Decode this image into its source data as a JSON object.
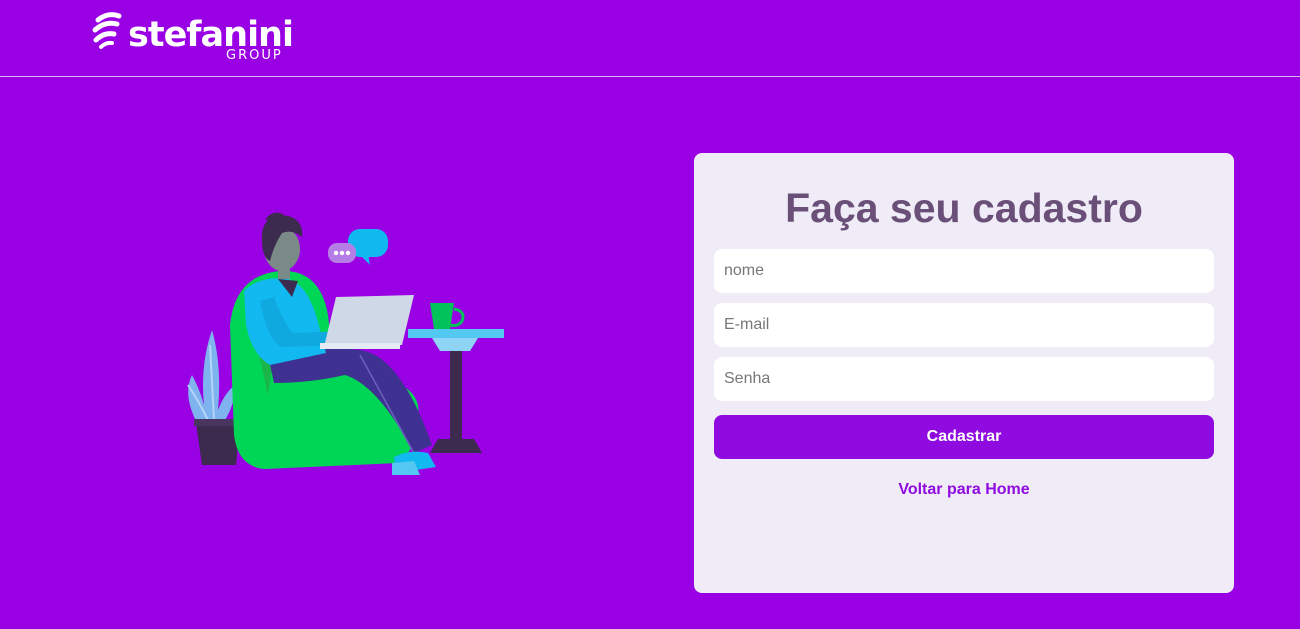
{
  "header": {
    "logo": {
      "word": "stefanini",
      "sub": "GROUP"
    }
  },
  "illustration": {
    "icon": "person-with-laptop-illustration"
  },
  "signup": {
    "title": "Faça seu cadastro",
    "name_placeholder": "nome",
    "email_placeholder": "E-mail",
    "password_placeholder": "Senha",
    "submit_label": "Cadastrar",
    "back_link": "Voltar para Home"
  },
  "colors": {
    "background": "#9a00e4",
    "card": "#f0ecf7",
    "title": "#6a4f78",
    "accent": "#8f0be0"
  }
}
